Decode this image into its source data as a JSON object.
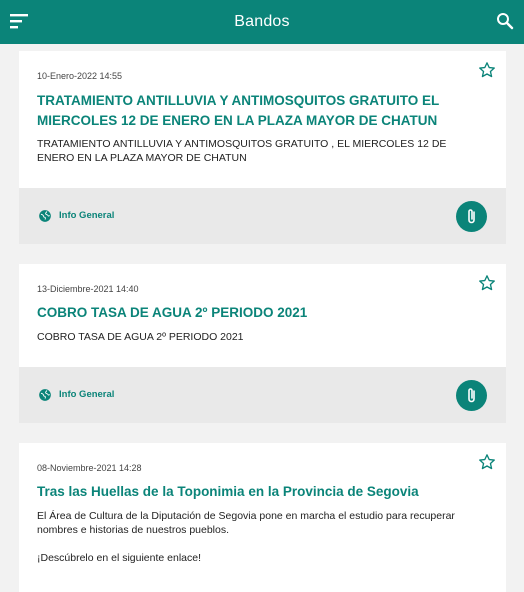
{
  "app": {
    "title": "Bandos"
  },
  "colors": {
    "primary": "#0b8479",
    "footer": "#e9e9e9",
    "background": "#f2f2f2"
  },
  "icons": {
    "menu": "menu-icon",
    "search": "search-icon",
    "star": "star-outline-icon",
    "globe": "globe-icon",
    "attach": "paperclip-icon"
  },
  "items": [
    {
      "date": "10-Enero-2022 14:55",
      "title": "TRATAMIENTO ANTILLUVIA Y ANTIMOSQUITOS GRATUITO EL MIERCOLES  12 DE ENERO EN LA PLAZA MAYOR DE CHATUN",
      "body": "TRATAMIENTO ANTILLUVIA Y ANTIMOSQUITOS GRATUITO , EL MIERCOLES 12 DE ENERO EN LA PLAZA MAYOR DE CHATUN",
      "category": "Info General"
    },
    {
      "date": "13-Diciembre-2021 14:40",
      "title": "COBRO TASA DE AGUA 2º PERIODO 2021",
      "body": "COBRO TASA DE AGUA 2º PERIODO 2021",
      "category": "Info General"
    },
    {
      "date": "08-Noviembre-2021 14:28",
      "title": "Tras las Huellas de la Toponimia en la Provincia de Segovia",
      "body": "El Área de Cultura de la Diputación de Segovia pone en marcha el estudio para recuperar nombres e historias de nuestros pueblos.\n\n¡Descúbrelo en el siguiente enlace!",
      "category": ""
    }
  ]
}
